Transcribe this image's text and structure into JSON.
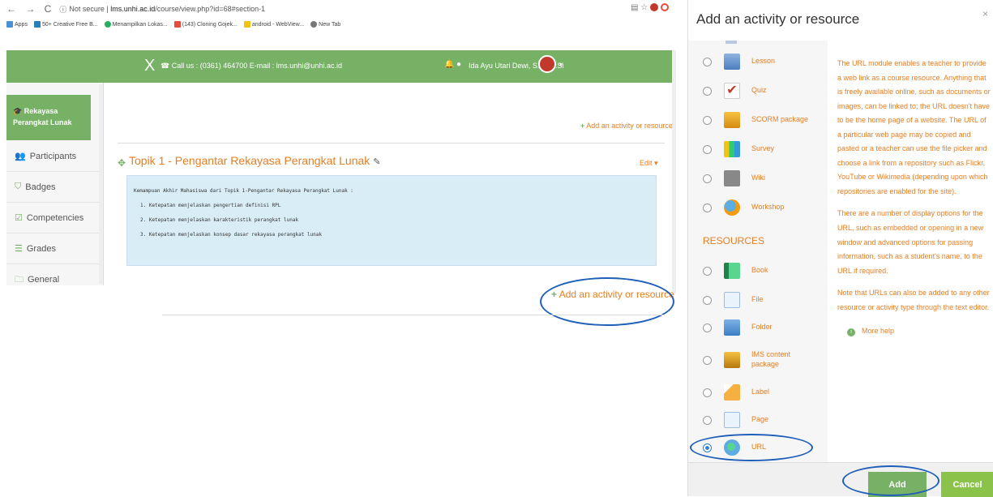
{
  "browser": {
    "url_prefix": "Not secure",
    "url_host": "lms.unhi.ac.id",
    "url_path": "/course/view.php?id=68#section-1",
    "bookmarks": [
      "Apps",
      "50+ Creative Free B...",
      "Menampilkan Lokas...",
      "(143) Cloning Gojek...",
      "android - WebView...",
      "New Tab"
    ],
    "header": {
      "logo": "X",
      "contact": "Call us : (0361) 464700  E-mail : lms.unhi@unhi.ac.id",
      "user": "Ida Ayu Utari Dewi, S.T., M.Si"
    }
  },
  "sidebar": {
    "active": "Rekayasa Perangkat Lunak",
    "items": [
      "Participants",
      "Badges",
      "Competencies",
      "Grades",
      "General"
    ]
  },
  "course": {
    "top_add_link": "Add an activity or resource",
    "topic_title": "Topik 1 - Pengantar Rekayasa Perangkat Lunak",
    "edit_label": "Edit",
    "summary_heading": "Kemampuan Akhir Mahasiswa dari Topik 1-Pengantar Rekayasa Perangkat Lunak  :",
    "summary_items": [
      "1. Ketepatan menjelaskan pengertian definisi RPL",
      "2. Ketepatan menjelaskan karakteristik perangkat lunak",
      "3. Ketepatan menjelaskan konsep dasar rekayasa perangkat lunak"
    ],
    "bottom_add_link": "Add an activity or resource"
  },
  "dialog": {
    "title": "Add an activity or resource",
    "close": "×",
    "activities": [
      "Lesson",
      "Quiz",
      "SCORM package",
      "Survey",
      "Wiki",
      "Workshop"
    ],
    "resources_heading": "RESOURCES",
    "resources": [
      "Book",
      "File",
      "Folder",
      "IMS content package",
      "Label",
      "Page",
      "URL"
    ],
    "selected": "URL",
    "description": [
      "The URL module enables a teacher to provide a web link as a course resource. Anything that is freely available online, such as documents or images, can be linked to; the URL doesn't have to be the home page of a website. The URL of a particular web page may be copied and pasted or a teacher can use the file picker and choose a link from a repository such as Flickr, YouTube or Wikimedia (depending upon which repositories are enabled for the site).",
      "There are a number of display options for the URL, such as embedded or opening in a new window and advanced options for passing information, such as a student's name, to the URL if required.",
      "Note that URLs can also be added to any other resource or activity type through the text editor."
    ],
    "more_help": "More help",
    "add_button": "Add",
    "cancel_button": "Cancel"
  },
  "colors": {
    "green": "#76b165",
    "orange": "#e67e22",
    "highlight_blue": "#1f5fb8",
    "summary_bg": "#d9edf7"
  }
}
